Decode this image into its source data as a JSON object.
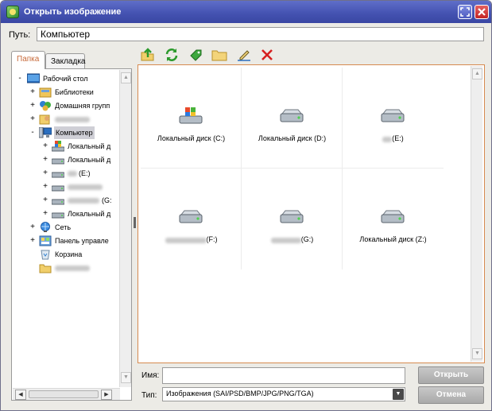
{
  "window": {
    "title": "Открыть изображение"
  },
  "path": {
    "label": "Путь:",
    "value": "Компьютер"
  },
  "tabs": [
    {
      "label": "Папка"
    },
    {
      "label": "Закладка"
    }
  ],
  "tree": {
    "items": [
      {
        "toggle": "-",
        "label": "Рабочий стол",
        "icon": "desktop-icon"
      },
      {
        "toggle": "+",
        "label": "Библиотеки",
        "icon": "libraries-icon"
      },
      {
        "toggle": "+",
        "label": "Домашняя групп",
        "icon": "homegroup-icon"
      },
      {
        "toggle": "+",
        "label": "",
        "icon": "user-folder-icon"
      },
      {
        "toggle": "-",
        "label": "Компьютер",
        "icon": "computer-icon"
      },
      {
        "toggle": "+",
        "label": "Локальный д",
        "icon": "windows-drive-icon"
      },
      {
        "toggle": "+",
        "label": "Локальный д",
        "icon": "drive-icon"
      },
      {
        "toggle": "+",
        "label": "(E:)",
        "icon": "drive-icon"
      },
      {
        "toggle": "+",
        "label": "",
        "icon": "drive-icon"
      },
      {
        "toggle": "+",
        "label": "(G:",
        "icon": "drive-icon"
      },
      {
        "toggle": "+",
        "label": "Локальный д",
        "icon": "drive-icon"
      },
      {
        "toggle": "+",
        "label": "Сеть",
        "icon": "network-icon"
      },
      {
        "toggle": "+",
        "label": "Панель управле",
        "icon": "control-panel-icon"
      },
      {
        "toggle": "",
        "label": "Корзина",
        "icon": "recycle-bin-icon"
      },
      {
        "toggle": "",
        "label": "",
        "icon": "folder-icon"
      }
    ]
  },
  "toolbar": {
    "buttons": [
      "up-folder-icon",
      "refresh-icon",
      "bookmark-add-icon",
      "new-folder-icon",
      "rename-icon",
      "delete-icon"
    ]
  },
  "files": [
    {
      "label": "Локальный диск (C:)",
      "icon": "windows-drive-icon"
    },
    {
      "label": "Локальный диск (D:)",
      "icon": "drive-icon"
    },
    {
      "label": "(E:)",
      "icon": "drive-icon"
    },
    {
      "label": "(F:)",
      "icon": "drive-icon"
    },
    {
      "label": "(G:)",
      "icon": "drive-icon"
    },
    {
      "label": "Локальный диск (Z:)",
      "icon": "drive-icon"
    }
  ],
  "form": {
    "name_label": "Имя:",
    "name_value": "",
    "type_label": "Тип:",
    "type_value": "Изображения (SAI/PSD/BMP/JPG/PNG/TGA)",
    "open_label": "Открыть",
    "cancel_label": "Отмена"
  },
  "colors": {
    "titlebar": "#4351b0",
    "panel_border_accent": "#d68a50",
    "active_tab_text": "#c76a3a",
    "delete_red": "#d62020"
  }
}
